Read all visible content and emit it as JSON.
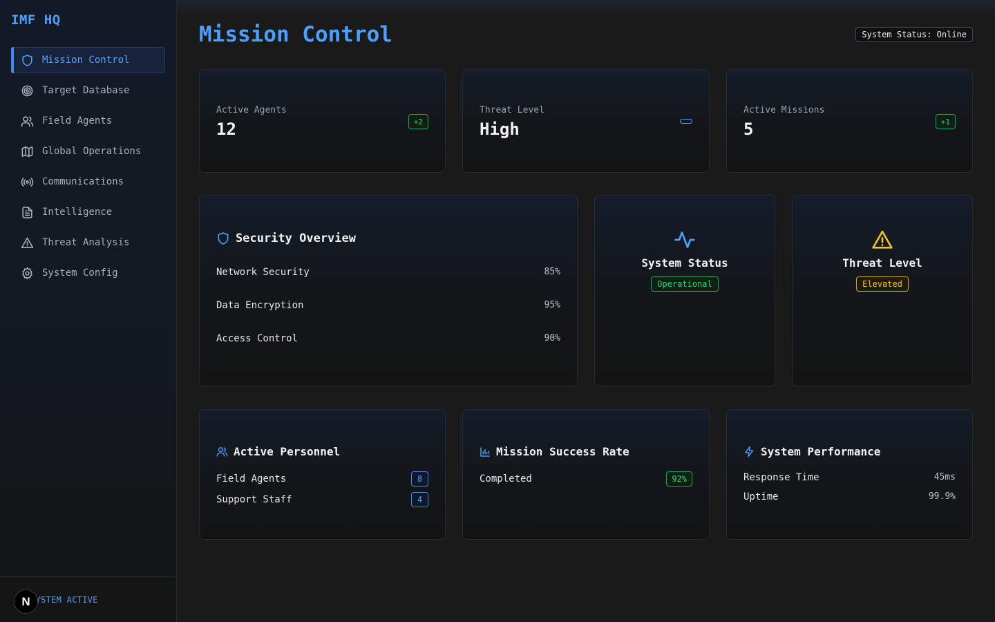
{
  "app": {
    "brand": "IMF HQ",
    "footer_status": "SYSTEM ACTIVE",
    "footer_badge": "N"
  },
  "sidebar": {
    "items": [
      {
        "label": "Mission Control",
        "icon": "shield-icon",
        "active": true
      },
      {
        "label": "Target Database",
        "icon": "target-icon",
        "active": false
      },
      {
        "label": "Field Agents",
        "icon": "users-icon",
        "active": false
      },
      {
        "label": "Global Operations",
        "icon": "map-icon",
        "active": false
      },
      {
        "label": "Communications",
        "icon": "radio-icon",
        "active": false
      },
      {
        "label": "Intelligence",
        "icon": "document-icon",
        "active": false
      },
      {
        "label": "Threat Analysis",
        "icon": "warning-icon",
        "active": false
      },
      {
        "label": "System Config",
        "icon": "gear-icon",
        "active": false
      }
    ]
  },
  "header": {
    "title": "Mission Control",
    "status": "System Status: Online"
  },
  "stats": [
    {
      "label": "Active Agents",
      "value": "12",
      "badge": "+2"
    },
    {
      "label": "Threat Level",
      "value": "High",
      "badge": ""
    },
    {
      "label": "Active Missions",
      "value": "5",
      "badge": "+1"
    }
  ],
  "security": {
    "title": "Security Overview",
    "rows": [
      {
        "label": "Network Security",
        "value": "85%"
      },
      {
        "label": "Data Encryption",
        "value": "95%"
      },
      {
        "label": "Access Control",
        "value": "90%"
      }
    ]
  },
  "system_status": {
    "title": "System Status",
    "chip": "Operational"
  },
  "threat": {
    "title": "Threat Level",
    "chip": "Elevated"
  },
  "personnel": {
    "title": "Active Personnel",
    "rows": [
      {
        "label": "Field Agents",
        "value": "8"
      },
      {
        "label": "Support Staff",
        "value": "4"
      }
    ]
  },
  "mission_rate": {
    "title": "Mission Success Rate",
    "rows": [
      {
        "label": "Completed",
        "value": "92%"
      }
    ]
  },
  "performance": {
    "title": "System Performance",
    "rows": [
      {
        "label": "Response Time",
        "value": "45ms"
      },
      {
        "label": "Uptime",
        "value": "99.9%"
      }
    ]
  },
  "colors": {
    "accent": "#4d9fff",
    "success": "#2fd66e",
    "warning": "#f0c22e",
    "background": "#1a1a1a"
  }
}
